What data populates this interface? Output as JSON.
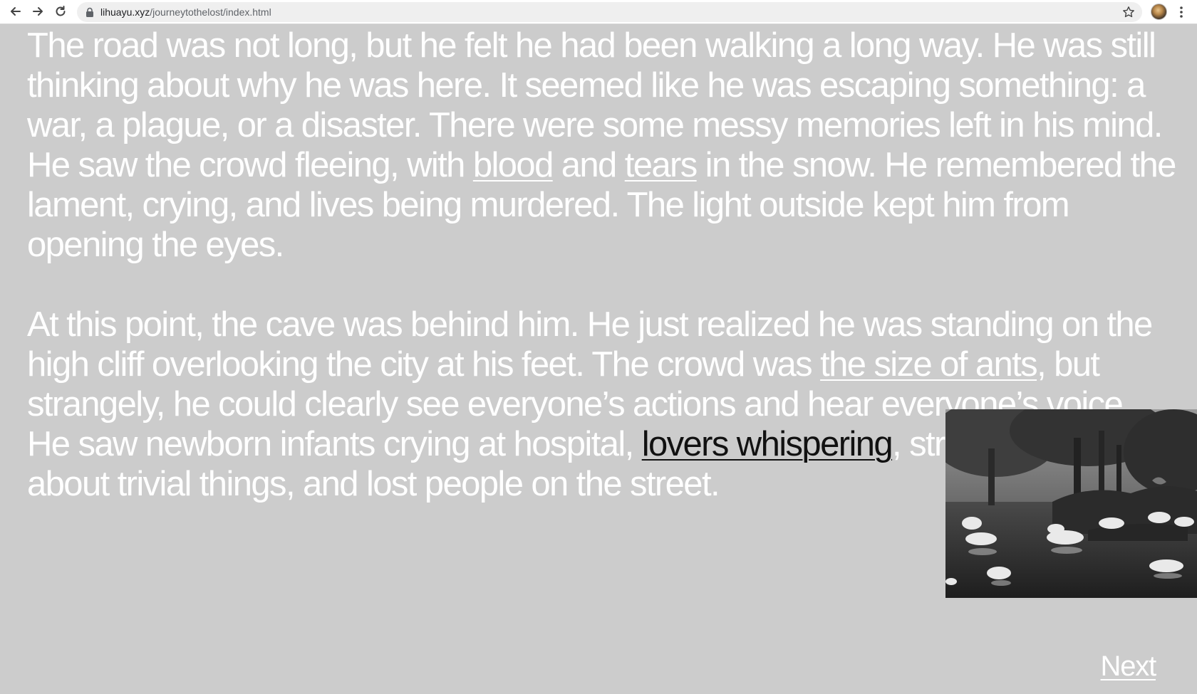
{
  "browser": {
    "url_domain": "lihuayu.xyz",
    "url_path": "/journeytothelost/index.html",
    "icons": {
      "back": "back-arrow-icon",
      "forward": "forward-arrow-icon",
      "reload": "reload-icon",
      "lock": "lock-icon",
      "bookmark": "star-icon",
      "profile": "avatar",
      "menu": "kebab-menu-icon"
    }
  },
  "story": {
    "paragraph1": {
      "part1": "The road was not long, but he felt he had been walking a long way. He was still thinking about why he was here. It seemed like he was escaping something: a war, a plague, or a disaster. There were some messy memories left in his mind. He saw the crowd fleeing, with ",
      "link1": "blood",
      "part2": " and ",
      "link2": "tears",
      "part3": " in the snow. He remembered the lament, crying, and lives being murdered. The light outside kept him from opening the eyes."
    },
    "paragraph2": {
      "part1": "At this point, the cave was behind him. He just realized he was standing on the high cliff overlooking the city at his feet. The crowd was ",
      "link1": "the size of ants",
      "part2": ", but strangely, he could clearly see everyone’s actions and hear everyone’s voice. He saw newborn infants crying at hospital, ",
      "link2": "lovers whispering",
      "part3": ", strangers arguing about trivial things, and lost people on the street."
    }
  },
  "image": {
    "subject": "black-and-white photo of swans on dark water under trees"
  },
  "navigation": {
    "next_label": "Next"
  },
  "colors": {
    "page_background": "#cccccc",
    "text": "#ffffff",
    "active_link": "#111111"
  }
}
